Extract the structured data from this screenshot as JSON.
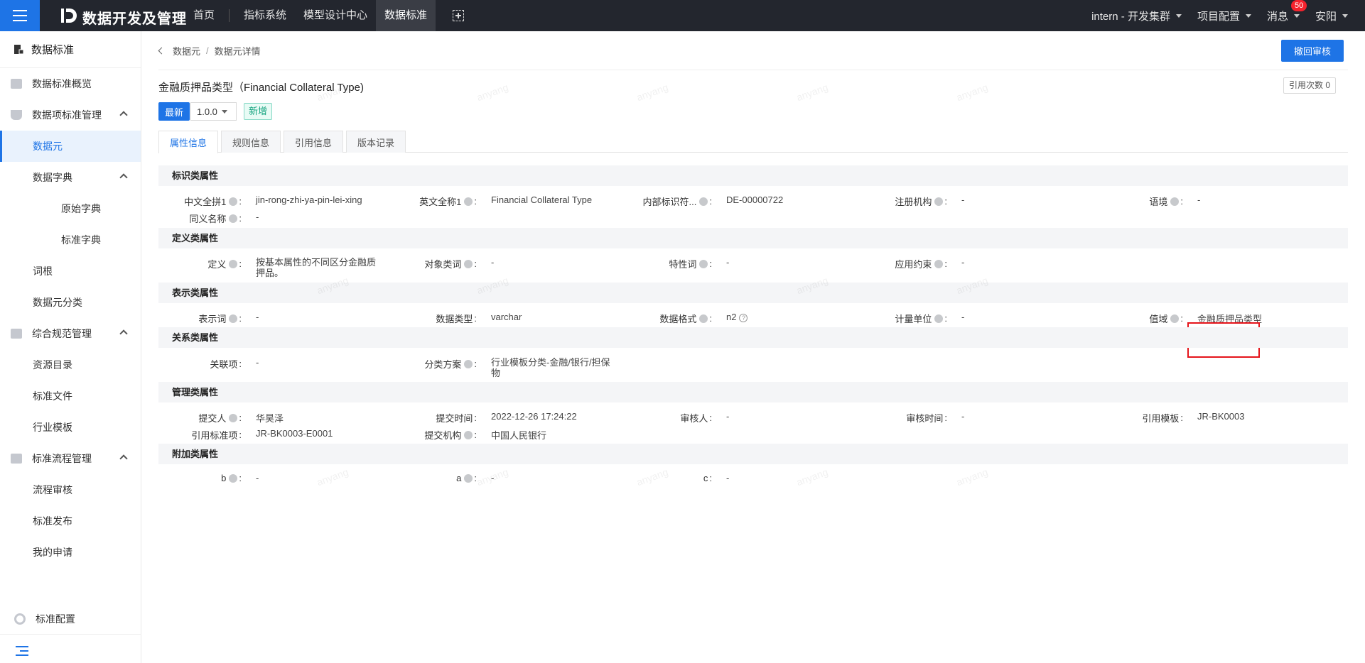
{
  "app": {
    "title": "数据开发及管理"
  },
  "nav": [
    "首页",
    "指标系统",
    "模型设计中心",
    "数据标准"
  ],
  "top_right": {
    "cluster": "intern - 开发集群",
    "project_config": "项目配置",
    "messages": "消息",
    "message_count": "50",
    "user": "安阳"
  },
  "sidebar": {
    "header": "数据标准",
    "items": [
      {
        "label": "数据标准概览"
      },
      {
        "label": "数据项标准管理"
      },
      {
        "label": "数据元"
      },
      {
        "label": "数据字典"
      },
      {
        "label": "原始字典"
      },
      {
        "label": "标准字典"
      },
      {
        "label": "词根"
      },
      {
        "label": "数据元分类"
      },
      {
        "label": "综合规范管理"
      },
      {
        "label": "资源目录"
      },
      {
        "label": "标准文件"
      },
      {
        "label": "行业模板"
      },
      {
        "label": "标准流程管理"
      },
      {
        "label": "流程审核"
      },
      {
        "label": "标准发布"
      },
      {
        "label": "我的申请"
      }
    ],
    "config": "标准配置"
  },
  "breadcrumb": [
    "数据元",
    "数据元详情"
  ],
  "actions": {
    "withdraw": "撤回审核"
  },
  "title": "金融质押品类型（Financial Collateral Type)",
  "ref_count": "引用次数 0",
  "tag_latest": "最新",
  "version": "1.0.0",
  "tag_new": "新增",
  "tabs": [
    "属性信息",
    "规则信息",
    "引用信息",
    "版本记录"
  ],
  "sections": {
    "identity": {
      "title": "标识类属性",
      "fields": [
        {
          "label": "中文全拼1",
          "value": "jin-rong-zhi-ya-pin-lei-xing"
        },
        {
          "label": "英文全称1",
          "value": "Financial Collateral Type"
        },
        {
          "label": "内部标识符...",
          "value": "DE-00000722"
        },
        {
          "label": "注册机构",
          "value": "-"
        },
        {
          "label": "语境",
          "value": "-"
        },
        {
          "label": "同义名称",
          "value": "-"
        }
      ]
    },
    "definition": {
      "title": "定义类属性",
      "fields": [
        {
          "label": "定义",
          "value": "按基本属性的不同区分金融质押品。"
        },
        {
          "label": "对象类词",
          "value": "-"
        },
        {
          "label": "特性词",
          "value": "-"
        },
        {
          "label": "应用约束",
          "value": "-"
        }
      ]
    },
    "representation": {
      "title": "表示类属性",
      "fields": [
        {
          "label": "表示词",
          "value": "-"
        },
        {
          "label": "数据类型",
          "value": "varchar"
        },
        {
          "label": "数据格式",
          "value": "n2"
        },
        {
          "label": "计量单位",
          "value": "-"
        },
        {
          "label": "值域",
          "value": "金融质押品类型"
        }
      ]
    },
    "relation": {
      "title": "关系类属性",
      "fields": [
        {
          "label": "关联项",
          "value": "-"
        },
        {
          "label": "分类方案",
          "value": "行业模板分类-金融/银行/担保物"
        }
      ]
    },
    "management": {
      "title": "管理类属性",
      "fields": [
        {
          "label": "提交人",
          "value": "华昊泽"
        },
        {
          "label": "提交时间",
          "value": "2022-12-26 17:24:22"
        },
        {
          "label": "审核人",
          "value": "-"
        },
        {
          "label": "审核时间",
          "value": "-"
        },
        {
          "label": "引用模板",
          "value": "JR-BK0003"
        },
        {
          "label": "引用标准项",
          "value": "JR-BK0003-E0001"
        },
        {
          "label": "提交机构",
          "value": "中国人民银行"
        }
      ]
    },
    "additional": {
      "title": "附加类属性",
      "fields": [
        {
          "label": "b",
          "value": "-"
        },
        {
          "label": "a",
          "value": "-"
        },
        {
          "label": "c",
          "value": "-"
        }
      ]
    }
  },
  "watermark": "anyang",
  "colors": {
    "primary": "#1e74e6",
    "topbar": "#23262e",
    "highlight": "#e5141b"
  }
}
